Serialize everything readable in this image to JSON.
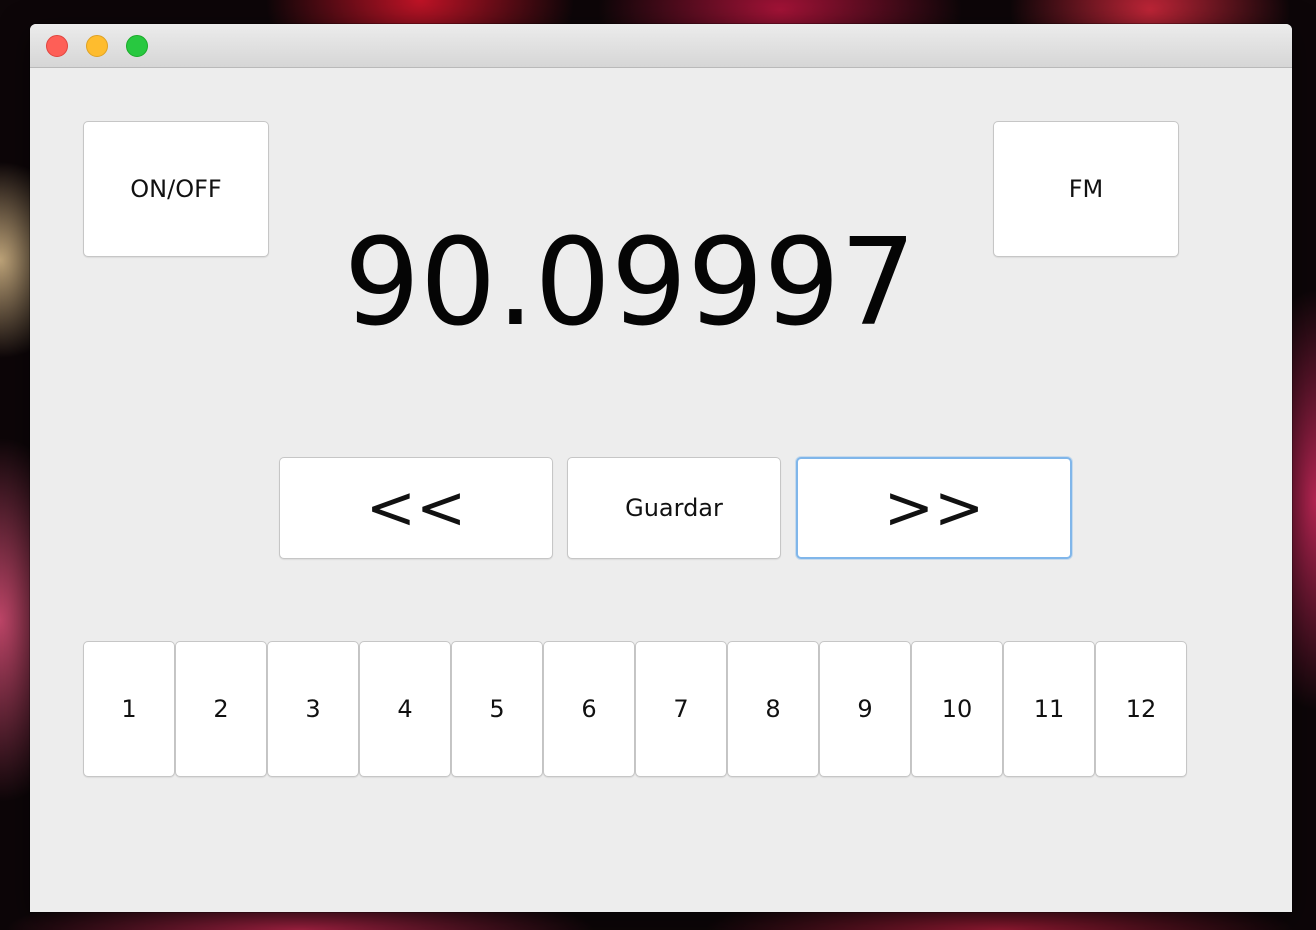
{
  "window": {
    "controls": [
      "close",
      "minimize",
      "zoom"
    ]
  },
  "radio": {
    "power_label": "ON/OFF",
    "band_label": "FM",
    "frequency": "90.09997",
    "seek_back_label": "<<",
    "save_label": "Guardar",
    "seek_forward_label": ">>"
  },
  "presets": [
    "1",
    "2",
    "3",
    "4",
    "5",
    "6",
    "7",
    "8",
    "9",
    "10",
    "11",
    "12"
  ],
  "colors": {
    "window_bg": "#ededed",
    "button_bg": "#ffffff",
    "focus_ring": "#80b6ea",
    "close": "#fe5f57",
    "minimize": "#febc2e",
    "zoom": "#28c840"
  }
}
